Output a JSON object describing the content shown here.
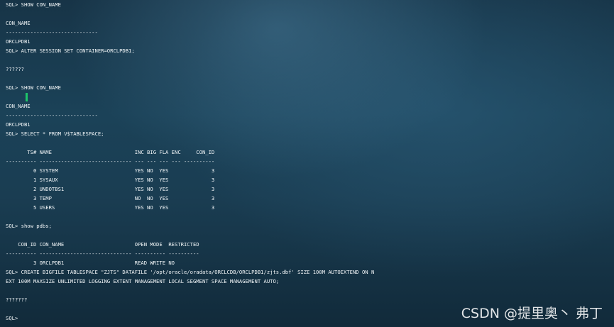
{
  "terminal": {
    "lines": [
      "SQL> SHOW CON_NAME",
      "",
      "CON_NAME",
      "------------------------------",
      "ORCLPDB1",
      "SQL> ALTER SESSION SET CONTAINER=ORCLPDB1;",
      "",
      "??????",
      "",
      "SQL> SHOW CON_NAME",
      "",
      "CON_NAME",
      "------------------------------",
      "ORCLPDB1",
      "SQL> SELECT * FROM V$TABLESPACE;",
      "",
      "       TS# NAME                           INC BIG FLA ENC     CON_ID",
      "---------- ------------------------------ --- --- --- --- ----------",
      "         0 SYSTEM                         YES NO  YES              3",
      "         1 SYSAUX                         YES NO  YES              3",
      "         2 UNDOTBS1                       YES NO  YES              3",
      "         3 TEMP                           NO  NO  YES              3",
      "         5 USERS                          YES NO  YES              3",
      "",
      "SQL> show pdbs;",
      "",
      "    CON_ID CON_NAME                       OPEN MODE  RESTRICTED",
      "---------- ------------------------------ ---------- ----------",
      "         3 ORCLPDB1                       READ WRITE NO",
      "SQL> CREATE BIGFILE TABLESPACE \"ZJTS\" DATAFILE '/opt/oracle/oradata/ORCLCDB/ORCLPDB1/zjts.dbf' SIZE 100M AUTOEXTEND ON N",
      "EXT 100M MAXSIZE UNLIMITED LOGGING EXTENT MANAGEMENT LOCAL SEGMENT SPACE MANAGEMENT AUTO;",
      "",
      "???????",
      "",
      "SQL>"
    ]
  },
  "watermark": "CSDN @提里奥丶 弗丁",
  "colors": {
    "terminal_text": "#f2f6f8",
    "cursor": "#1ec46a",
    "background": "#1b4258"
  }
}
